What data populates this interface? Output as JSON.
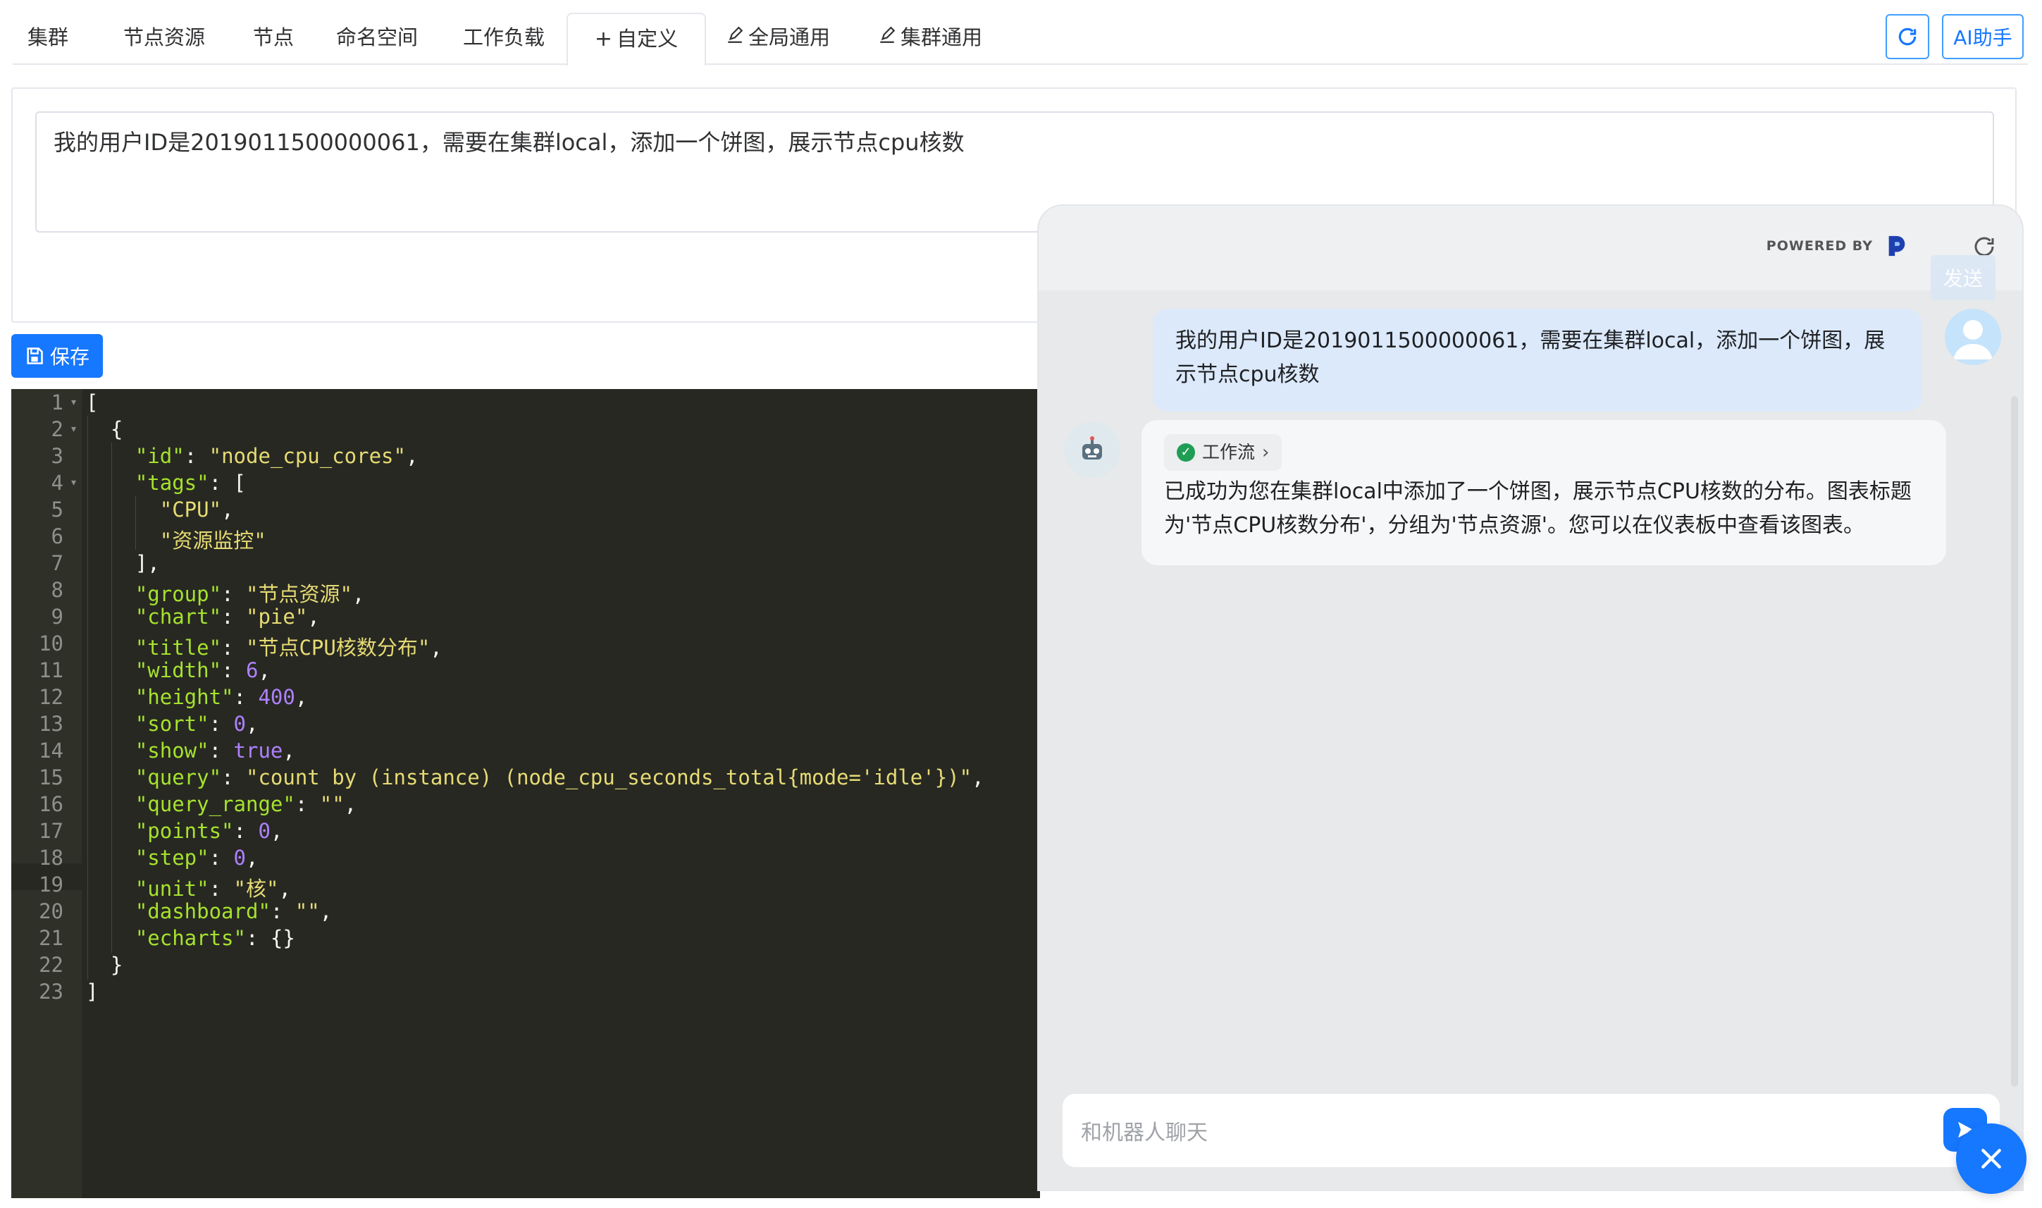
{
  "tabs": [
    {
      "label": "集群"
    },
    {
      "label": "节点资源"
    },
    {
      "label": "节点"
    },
    {
      "label": "命名空间"
    },
    {
      "label": "工作负载"
    },
    {
      "label": "自定义",
      "icon": "plus-icon",
      "active": true
    },
    {
      "label": "全局通用",
      "icon": "edit-icon"
    },
    {
      "label": "集群通用",
      "icon": "edit-icon"
    }
  ],
  "toolbar": {
    "refresh_icon": "refresh-icon",
    "ai_label": "AI助手"
  },
  "prompt": {
    "text": "我的用户ID是2019011500000061，需要在集群local，添加一个饼图，展示节点cpu核数"
  },
  "save_button": {
    "label": "保存",
    "icon": "save-icon"
  },
  "editor": {
    "line_numbers": [
      "1",
      "2",
      "3",
      "4",
      "5",
      "6",
      "7",
      "8",
      "9",
      "10",
      "11",
      "12",
      "13",
      "14",
      "15",
      "16",
      "17",
      "18",
      "19",
      "20",
      "21",
      "22",
      "23"
    ],
    "code": {
      "id_key": "\"id\"",
      "id_val": "\"node_cpu_cores\"",
      "tags_key": "\"tags\"",
      "tag1": "\"CPU\"",
      "tag2": "\"资源监控\"",
      "group_key": "\"group\"",
      "group_val": "\"节点资源\"",
      "chart_key": "\"chart\"",
      "chart_val": "\"pie\"",
      "title_key": "\"title\"",
      "title_val": "\"节点CPU核数分布\"",
      "width_key": "\"width\"",
      "width_val": "6",
      "height_key": "\"height\"",
      "height_val": "400",
      "sort_key": "\"sort\"",
      "sort_val": "0",
      "show_key": "\"show\"",
      "show_val": "true",
      "query_key": "\"query\"",
      "query_val": "\"count by (instance) (node_cpu_seconds_total{mode='idle'})\"",
      "query_range_key": "\"query_range\"",
      "query_range_val": "\"\"",
      "points_key": "\"points\"",
      "points_val": "0",
      "step_key": "\"step\"",
      "step_val": "0",
      "unit_key": "\"unit\"",
      "unit_val": "\"核\"",
      "dashboard_key": "\"dashboard\"",
      "dashboard_val": "\"\"",
      "echarts_key": "\"echarts\"",
      "echarts_val": "{}"
    }
  },
  "chat": {
    "powered_by": "POWERED BY",
    "send_label": "发送",
    "user_message": "我的用户ID是2019011500000061，需要在集群local，添加一个饼图，展示节点cpu核数",
    "workflow_label": "工作流",
    "bot_message": "已成功为您在集群local中添加了一个饼图，展示节点CPU核数的分布。图表标题为'节点CPU核数分布'，分组为'节点资源'。您可以在仪表板中查看该图表。",
    "input_placeholder": "和机器人聊天"
  },
  "colors": {
    "accent": "#1677ff",
    "editor_bg": "#272822",
    "user_bubble": "#dbe9fb"
  }
}
